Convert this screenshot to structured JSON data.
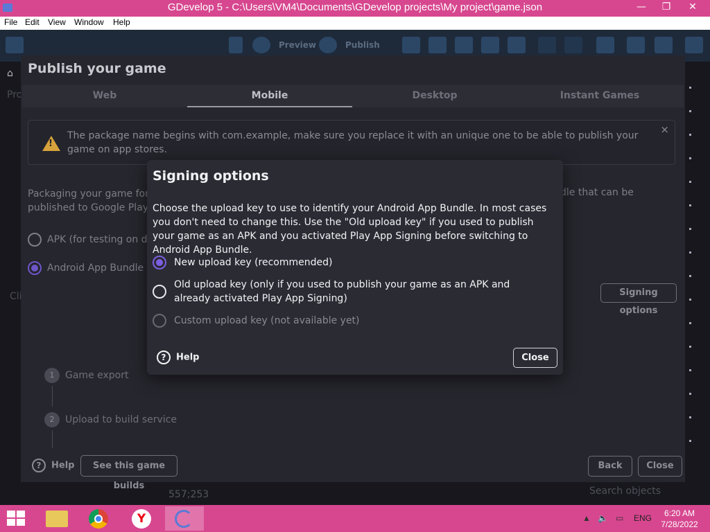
{
  "window": {
    "title": "GDevelop 5 - C:\\Users\\VM4\\Documents\\GDevelop projects\\My project\\game.json",
    "minimize": "—",
    "restore": "❐",
    "close": "✕"
  },
  "menu": [
    "File",
    "Edit",
    "View",
    "Window",
    "Help"
  ],
  "toolbar": {
    "preview_label": "Preview",
    "publish_label": "Publish"
  },
  "editor": {
    "coordinates": "557;253",
    "search_placeholder": "Search objects",
    "bg_text_1": "Pro",
    "bg_text_2": "Cli"
  },
  "publish": {
    "title": "Publish your game",
    "tabs": [
      "Web",
      "Mobile",
      "Desktop",
      "Instant Games"
    ],
    "active_tab": "Mobile",
    "warning": "The package name begins with com.example, make sure you replace it with an unique one to be able to publish your game on app stores.",
    "warning_close": "×",
    "packaging_left": "Packaging your game for Ar",
    "packaging_left2": "published to Google Play.",
    "packaging_right": "dle that can be",
    "apk_option": "APK (for testing on de",
    "aab_option": "Android App Bundle (f",
    "signing_options_button": "Signing options",
    "steps": [
      {
        "num": "1",
        "label": "Game export"
      },
      {
        "num": "2",
        "label": "Upload to build service"
      }
    ],
    "help_label": "Help",
    "see_builds_button": "See this game builds",
    "back_button": "Back",
    "close_button": "Close"
  },
  "signing_modal": {
    "title": "Signing options",
    "description": "Choose the upload key to use to identify your Android App Bundle. In most cases you don't need to change this. Use the \"Old upload key\" if you used to publish your game as an APK and you activated Play App Signing before switching to Android App Bundle.",
    "options": [
      {
        "label": "New upload key (recommended)",
        "selected": true,
        "disabled": false
      },
      {
        "label": "Old upload key (only if you used to publish your game as an APK and already activated Play App Signing)",
        "selected": false,
        "disabled": false
      },
      {
        "label": "Custom upload key (not available yet)",
        "selected": false,
        "disabled": true
      }
    ],
    "help_label": "Help",
    "close_label": "Close"
  },
  "taskbar": {
    "language": "ENG",
    "time": "6:20 AM",
    "date": "7/28/2022"
  }
}
